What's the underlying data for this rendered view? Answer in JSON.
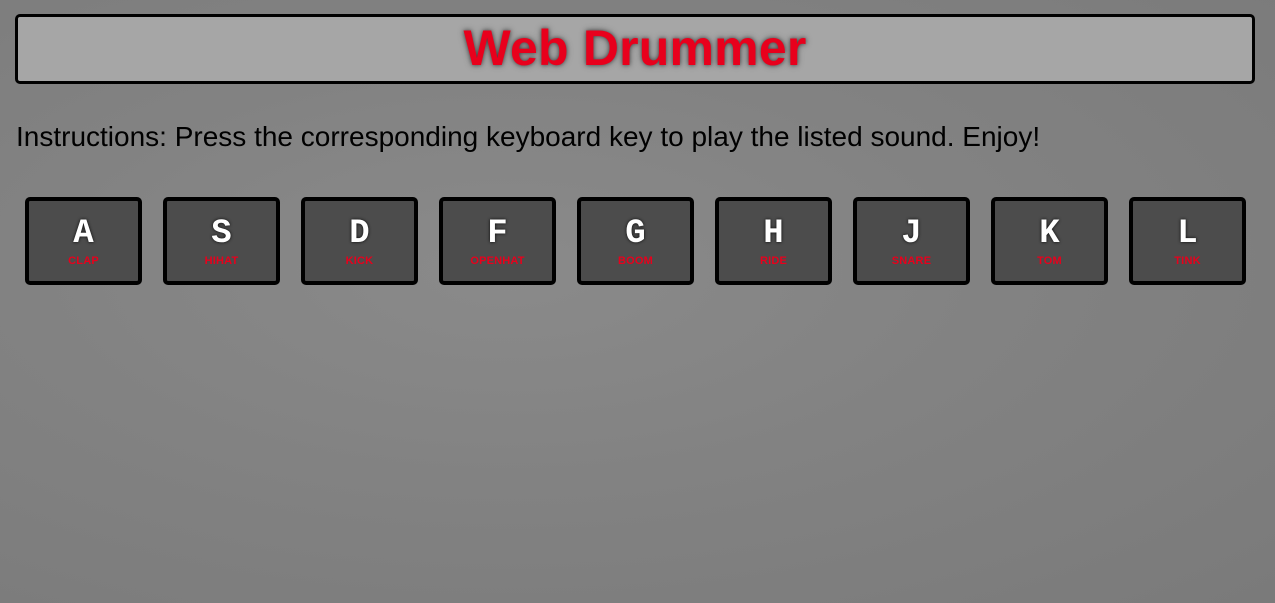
{
  "header": {
    "title": "Web Drummer"
  },
  "instructions": "Instructions: Press the corresponding keyboard key to play the listed sound. Enjoy!",
  "keys": [
    {
      "letter": "A",
      "sound": "CLAP"
    },
    {
      "letter": "S",
      "sound": "HIHAT"
    },
    {
      "letter": "D",
      "sound": "KICK"
    },
    {
      "letter": "F",
      "sound": "OPENHAT"
    },
    {
      "letter": "G",
      "sound": "BOOM"
    },
    {
      "letter": "H",
      "sound": "RIDE"
    },
    {
      "letter": "J",
      "sound": "SNARE"
    },
    {
      "letter": "K",
      "sound": "TOM"
    },
    {
      "letter": "L",
      "sound": "TINK"
    }
  ],
  "colors": {
    "background": "#828282",
    "header_background": "#a6a6a6",
    "title": "#e8001c",
    "key_background": "#4c4c4c",
    "key_letter": "#ffffff",
    "key_sound": "#e8001c",
    "border": "#000000"
  }
}
